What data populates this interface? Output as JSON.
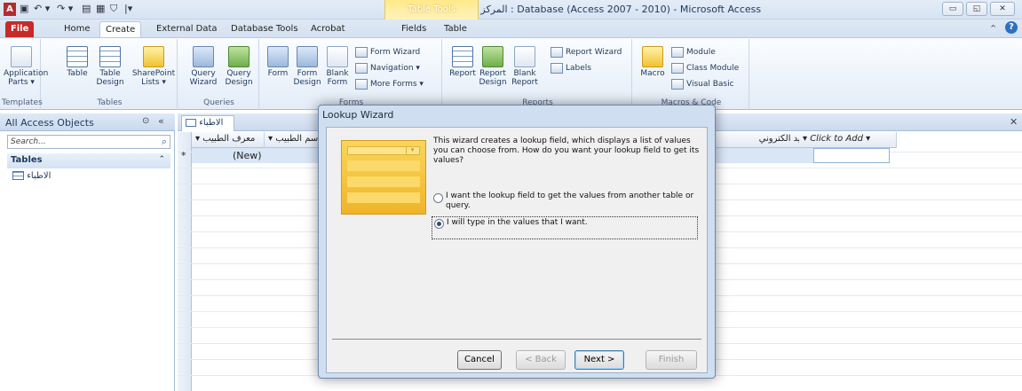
{
  "window": {
    "title": "Microsoft Access - (Access 2007 - 2010) Database : المركز الطبي",
    "title_display": "المركز الطبي : Database (Access 2007 - 2010)  -  Microsoft Access",
    "app_icon": "A",
    "context_tab_group": "Table Tools"
  },
  "ribbon_tabs": [
    "File",
    "Home",
    "Create",
    "External Data",
    "Database Tools",
    "Acrobat",
    "Fields",
    "Table"
  ],
  "ribbon": {
    "templates": {
      "label": "Templates",
      "application_parts": "Application Parts ▾"
    },
    "tables": {
      "label": "Tables",
      "table": "Table",
      "table_design": "Table Design",
      "sharepoint_lists": "SharePoint Lists ▾"
    },
    "queries": {
      "label": "Queries",
      "query_wizard": "Query Wizard",
      "query_design": "Query Design"
    },
    "forms": {
      "label": "Forms",
      "form": "Form",
      "form_design": "Form Design",
      "blank_form": "Blank Form",
      "form_wizard": "Form Wizard",
      "navigation": "Navigation ▾",
      "more_forms": "More Forms ▾"
    },
    "reports": {
      "label": "Reports",
      "report": "Report",
      "report_design": "Report Design",
      "blank_report": "Blank Report",
      "report_wizard": "Report Wizard",
      "labels": "Labels"
    },
    "macros": {
      "label": "Macros & Code",
      "macro": "Macro",
      "module": "Module",
      "class_module": "Class Module",
      "visual_basic": "Visual Basic"
    }
  },
  "nav_pane": {
    "header": "All Access Objects",
    "search_placeholder": "Search...",
    "group": "Tables",
    "items": [
      "الاطباء"
    ]
  },
  "document": {
    "tab": "الاطباء",
    "columns": [
      "معرف الطبيب",
      "اسم الطبيب",
      "بريد الكتروني",
      "Click to Add"
    ],
    "new_row": "(New)",
    "new_row_marker": "*"
  },
  "dialog": {
    "title": "Lookup Wizard",
    "intro": "This wizard creates a lookup field, which displays a list of values you can choose from.  How do you want your lookup field to get its values?",
    "options": [
      {
        "label": "I want the lookup field to get the values from another table or query.",
        "selected": false
      },
      {
        "label": "I will type in the values that I want.",
        "selected": true
      }
    ],
    "buttons": {
      "cancel": "Cancel",
      "back": "< Back",
      "next": "Next >",
      "finish": "Finish"
    }
  }
}
